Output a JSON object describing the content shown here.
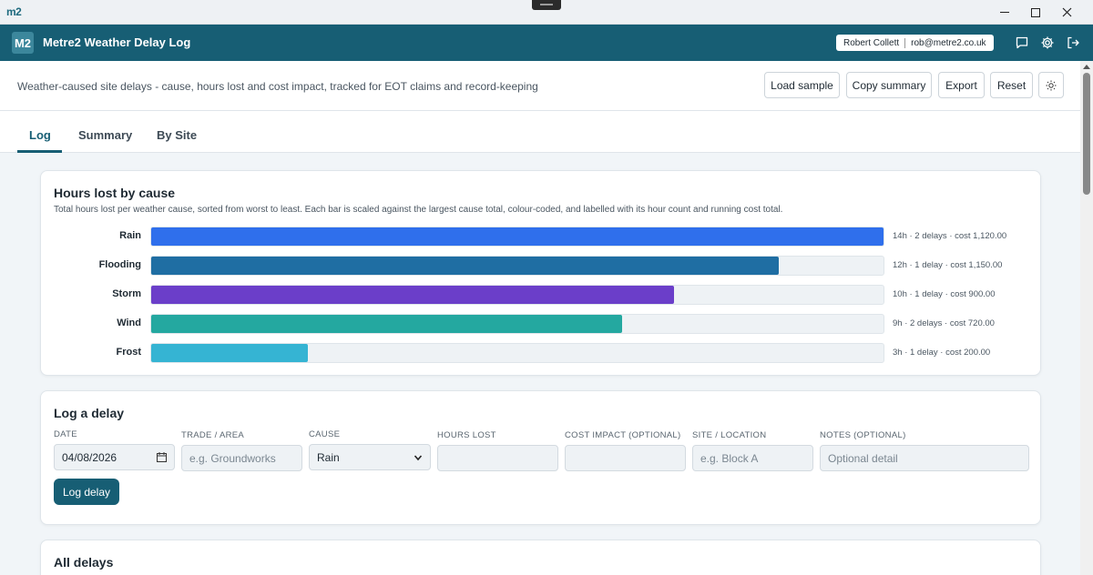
{
  "os": {
    "logo_text": "m2"
  },
  "header": {
    "logo": "M2",
    "title": "Metre2 Weather Delay Log",
    "user_name": "Robert Collett",
    "user_email": "rob@metre2.co.uk"
  },
  "toolbar": {
    "description": "Weather-caused site delays - cause, hours lost and cost impact, tracked for EOT claims and record-keeping",
    "load_sample": "Load sample",
    "copy_summary": "Copy summary",
    "export": "Export",
    "reset": "Reset"
  },
  "tabs": [
    {
      "label": "Log",
      "active": true
    },
    {
      "label": "Summary",
      "active": false
    },
    {
      "label": "By Site",
      "active": false
    }
  ],
  "chart_card": {
    "title": "Hours lost by cause",
    "description": "Total hours lost per weather cause, sorted from worst to least. Each bar is scaled against the largest cause total, colour-coded, and labelled with its hour count and running cost total."
  },
  "chart_data": {
    "type": "bar",
    "orientation": "horizontal",
    "categories": [
      "Rain",
      "Flooding",
      "Storm",
      "Wind",
      "Frost"
    ],
    "values": [
      14,
      12,
      10,
      9,
      3
    ],
    "colors": [
      "#2f6fec",
      "#1f6ea3",
      "#6b3ec9",
      "#24a8a0",
      "#35b4d3"
    ],
    "annotations": [
      "14h · 2 delays · cost 1,120.00",
      "12h · 1 delay · cost 1,150.00",
      "10h · 1 delay · cost 900.00",
      "9h · 2 delays · cost 720.00",
      "3h · 1 delay · cost 200.00"
    ],
    "xlim": [
      0,
      14
    ]
  },
  "form": {
    "title": "Log a delay",
    "date_label": "DATE",
    "date_value": "04/08/2026",
    "trade_label": "TRADE / AREA",
    "trade_placeholder": "e.g. Groundworks",
    "cause_label": "CAUSE",
    "cause_value": "Rain",
    "hours_label": "HOURS LOST",
    "cost_label": "COST IMPACT (OPTIONAL)",
    "site_label": "SITE / LOCATION",
    "site_placeholder": "e.g. Block A",
    "notes_label": "NOTES (OPTIONAL)",
    "notes_placeholder": "Optional detail",
    "submit": "Log delay"
  },
  "all_delays": {
    "title": "All delays"
  }
}
